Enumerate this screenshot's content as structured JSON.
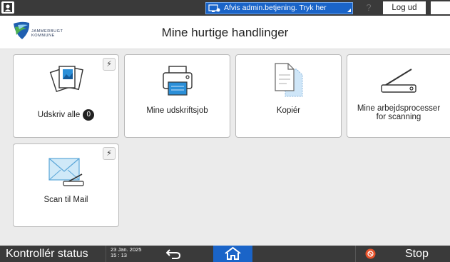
{
  "topbar": {
    "admin_banner": "Afvis admin.betjening. Tryk her",
    "help": "?",
    "logout": "Log ud"
  },
  "header": {
    "logo_text_line1": "JAMMERBUGT",
    "logo_text_line2": "KOMMUNE",
    "title": "Mine hurtige handlinger"
  },
  "tiles": [
    {
      "label": "Udskriv alle",
      "badge": "0",
      "pin": "⚡"
    },
    {
      "label": "Mine udskriftsjob"
    },
    {
      "label": "Kopiér"
    },
    {
      "label_line1": "Mine arbejdsprocesser",
      "label_line2": "for scanning"
    },
    {
      "label": "Scan til Mail",
      "pin": "⚡"
    }
  ],
  "bottombar": {
    "status": "Kontrollér status",
    "date": "23 Jan. 2025",
    "time": "15 : 13",
    "stop": "Stop"
  },
  "colors": {
    "bar": "#3a3a3a",
    "accent": "#1a64c8",
    "stop": "#e8522a"
  },
  "icons": {
    "user": "user-icon",
    "admin": "admin-monitor-icon",
    "night": "moon-icon",
    "print_all": "documents-icon",
    "print_jobs": "printer-icon",
    "copy": "copy-document-icon",
    "scan_workflow": "scanner-icon",
    "scan_mail": "envelope-scan-icon",
    "back": "back-arrow-icon",
    "home": "home-icon",
    "stop": "stop-icon"
  }
}
